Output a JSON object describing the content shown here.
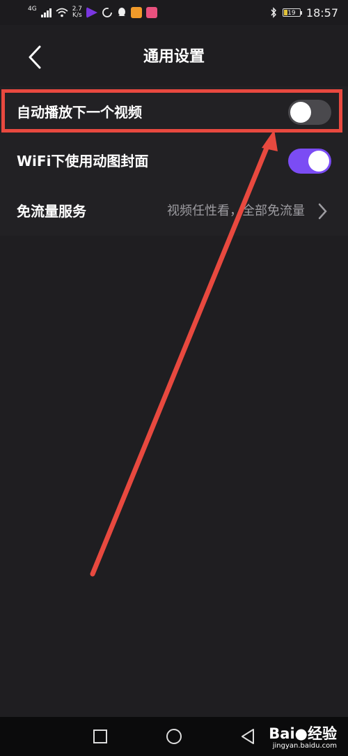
{
  "status_bar": {
    "network": "4G",
    "speed": "2.7\nK/s",
    "time": "18:57",
    "battery": "19",
    "colors": {
      "app1": "#7a36e0",
      "app2": "#f09a2a",
      "app3": "#e8517e"
    }
  },
  "header": {
    "title": "通用设置",
    "back_icon": "chevron-left-icon"
  },
  "settings": {
    "autoplay_label": "自动播放下一个视频",
    "autoplay_on": false,
    "wifi_cover_label": "WiFi下使用动图封面",
    "wifi_cover_on": true,
    "free_data_label": "免流量服务",
    "free_data_value": "视频任性看，全部免流量"
  },
  "watermark": {
    "brand": "Bai",
    "brand_tail": "经验",
    "url": "jingyan.baidu.com"
  },
  "colors": {
    "toggle_on": "#7b4cf4",
    "toggle_off": "#4a494d",
    "annotation": "#e8493f"
  }
}
